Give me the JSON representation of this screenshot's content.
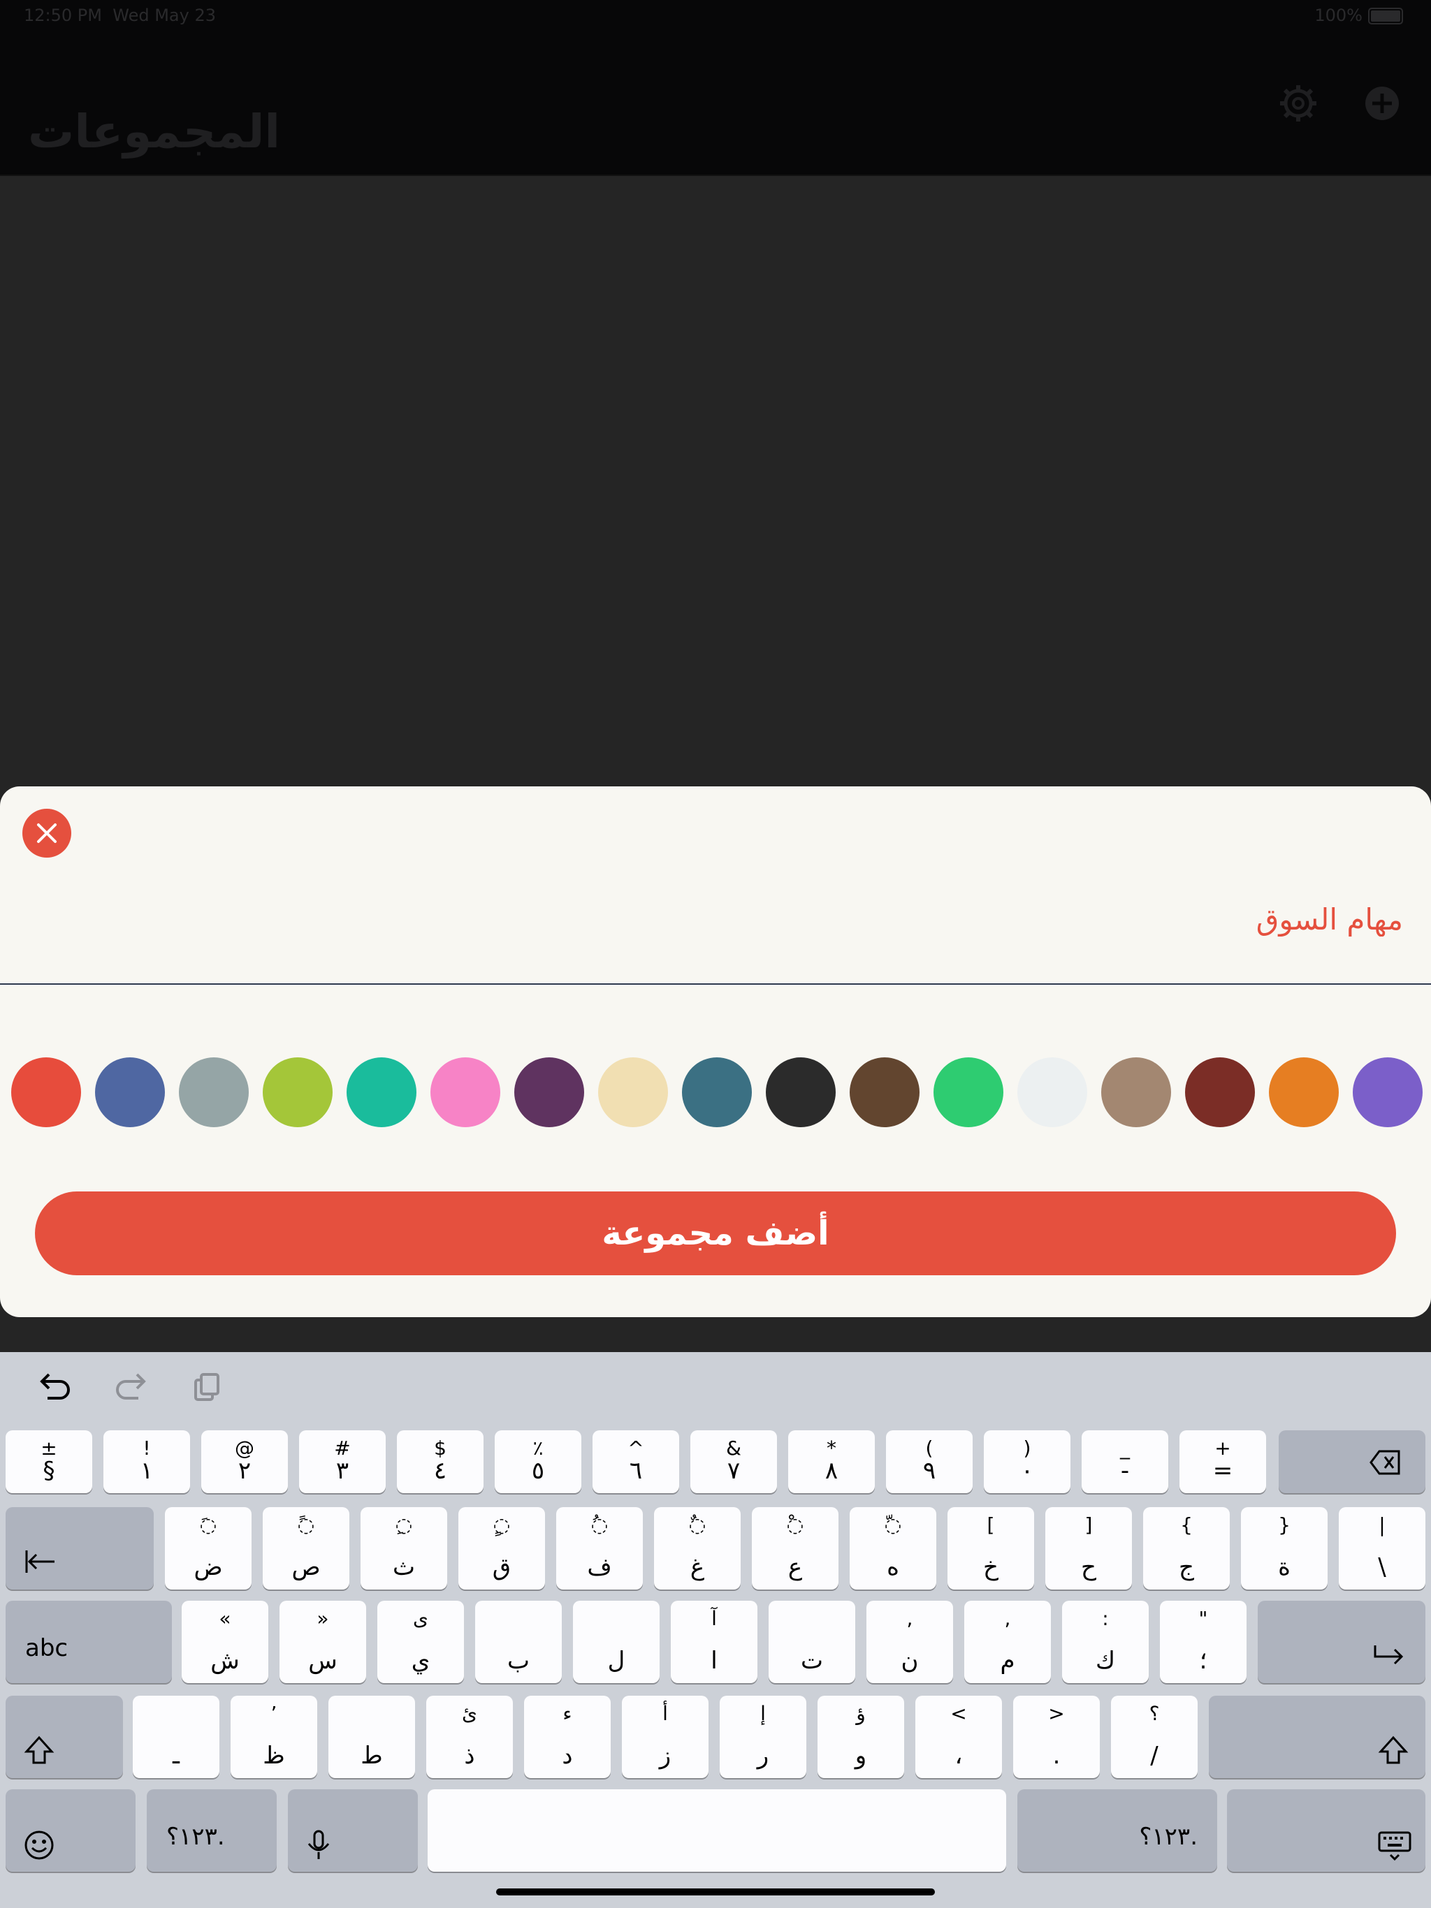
{
  "status": {
    "time": "12:50 PM",
    "date": "Wed May 23",
    "battery": "100%"
  },
  "nav": {
    "title": "المجموعات"
  },
  "sheet": {
    "group_name": "مهام السوق",
    "add_button": "أضف مجموعة",
    "colors": [
      "#e74c3c",
      "#4f67a2",
      "#95a5a6",
      "#a4c639",
      "#1abc9c",
      "#f783c6",
      "#5f3360",
      "#f1dfb2",
      "#3b7083",
      "#2b2b2b",
      "#62452f",
      "#2ecc71",
      "#ecf0f1",
      "#a38771",
      "#7b2d26",
      "#e67e22",
      "#7b5fc9"
    ]
  },
  "keyboard": {
    "rows": [
      [
        {
          "top": "±",
          "bot": "§"
        },
        {
          "top": "!",
          "bot": "١"
        },
        {
          "top": "@",
          "bot": "٢"
        },
        {
          "top": "#",
          "bot": "٣"
        },
        {
          "top": "$",
          "bot": "٤"
        },
        {
          "top": "٪",
          "bot": "٥"
        },
        {
          "top": "^",
          "bot": "٦"
        },
        {
          "top": "&",
          "bot": "٧"
        },
        {
          "top": "*",
          "bot": "٨"
        },
        {
          "top": "(",
          "bot": "٩"
        },
        {
          "top": ")",
          "bot": "٠"
        },
        {
          "top": "_",
          "bot": "-"
        },
        {
          "top": "+",
          "bot": "="
        }
      ],
      [
        {
          "top": "◌َ",
          "bot": "ض"
        },
        {
          "top": "◌ً",
          "bot": "ص"
        },
        {
          "top": "◌ِ",
          "bot": "ث"
        },
        {
          "top": "◌ٍ",
          "bot": "ق"
        },
        {
          "top": "◌ُ",
          "bot": "ف"
        },
        {
          "top": "◌ٌ",
          "bot": "غ"
        },
        {
          "top": "◌ْ",
          "bot": "ع"
        },
        {
          "top": "◌ّ",
          "bot": "ه"
        },
        {
          "top": "[",
          "bot": "خ"
        },
        {
          "top": "]",
          "bot": "ح"
        },
        {
          "top": "{",
          "bot": "ج"
        },
        {
          "top": "}",
          "bot": "ة"
        },
        {
          "top": "|",
          "bot": "\\"
        }
      ],
      [
        {
          "top": "«",
          "bot": "ش"
        },
        {
          "top": "»",
          "bot": "س"
        },
        {
          "top": "ى",
          "bot": "ي"
        },
        {
          "top": "",
          "bot": "ب"
        },
        {
          "top": "",
          "bot": "ل"
        },
        {
          "top": "آ",
          "bot": "ا"
        },
        {
          "top": "",
          "bot": "ت"
        },
        {
          "top": ",",
          "bot": "ن"
        },
        {
          "top": ",",
          "bot": "م"
        },
        {
          "top": ":",
          "bot": "ك"
        },
        {
          "top": "\"",
          "bot": "؛"
        }
      ],
      [
        {
          "top": "",
          "bot": "ـ"
        },
        {
          "top": "’",
          "bot": "ظ"
        },
        {
          "top": "",
          "bot": "ط"
        },
        {
          "top": "ئ",
          "bot": "ذ"
        },
        {
          "top": "ء",
          "bot": "د"
        },
        {
          "top": "أ",
          "bot": "ز"
        },
        {
          "top": "إ",
          "bot": "ر"
        },
        {
          "top": "ؤ",
          "bot": "و"
        },
        {
          "top": "<",
          "bot": "،"
        },
        {
          "top": ">",
          "bot": "."
        },
        {
          "top": "؟",
          "bot": "/"
        }
      ]
    ],
    "abc_label": "abc",
    "numbers_label": "١٢٣؟."
  }
}
